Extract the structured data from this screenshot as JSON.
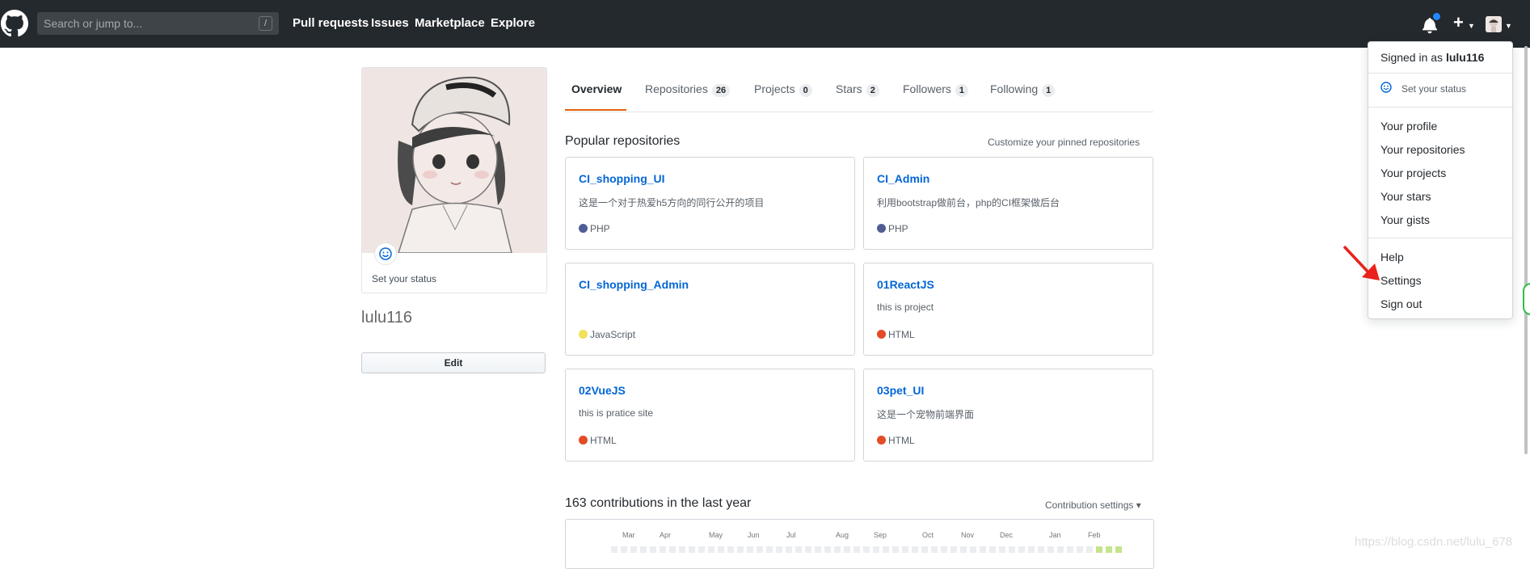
{
  "header": {
    "search_placeholder": "Search or jump to...",
    "slash_key": "/",
    "nav": [
      "Pull requests",
      "Issues",
      "Marketplace",
      "Explore"
    ],
    "plus_label": "+"
  },
  "sidebar": {
    "status_label": "Set your status",
    "username": "lulu116",
    "edit_label": "Edit"
  },
  "tabs": [
    {
      "label": "Overview",
      "count": null,
      "active": true
    },
    {
      "label": "Repositories",
      "count": "26"
    },
    {
      "label": "Projects",
      "count": "0"
    },
    {
      "label": "Stars",
      "count": "2"
    },
    {
      "label": "Followers",
      "count": "1"
    },
    {
      "label": "Following",
      "count": "1"
    }
  ],
  "popular": {
    "title": "Popular repositories",
    "customize_link": "Customize your pinned repositories",
    "repos": [
      {
        "name": "CI_shopping_UI",
        "desc": "这是一个对于热爱h5方向的同行公开的项目",
        "lang": "PHP",
        "color": "#4F5D95"
      },
      {
        "name": "CI_Admin",
        "desc": "利用bootstrap做前台，php的CI框架做后台",
        "lang": "PHP",
        "color": "#4F5D95"
      },
      {
        "name": "CI_shopping_Admin",
        "desc": "",
        "lang": "JavaScript",
        "color": "#f1e05a"
      },
      {
        "name": "01ReactJS",
        "desc": "this is project",
        "lang": "HTML",
        "color": "#e34c26"
      },
      {
        "name": "02VueJS",
        "desc": "this is pratice site",
        "lang": "HTML",
        "color": "#e34c26"
      },
      {
        "name": "03pet_UI",
        "desc": "这是一个宠物前端界面",
        "lang": "HTML",
        "color": "#e34c26"
      }
    ]
  },
  "contributions": {
    "title": "163 contributions in the last year",
    "settings_label": "Contribution settings ▾",
    "months": [
      "Mar",
      "Apr",
      "May",
      "Jun",
      "Jul",
      "Aug",
      "Sep",
      "Oct",
      "Nov",
      "Dec",
      "Jan",
      "Feb"
    ]
  },
  "dropdown": {
    "signed_in_prefix": "Signed in as ",
    "signed_in_user": "lulu116",
    "set_status": "Set your status",
    "group1": [
      "Your profile",
      "Your repositories",
      "Your projects",
      "Your stars",
      "Your gists"
    ],
    "group2": [
      "Help",
      "Settings",
      "Sign out"
    ]
  },
  "watermark": "https://blog.csdn.net/lulu_678",
  "colors": {
    "header": "#24292e",
    "link": "#0366d6",
    "accent": "#e36209",
    "arrow": "#e8231b"
  }
}
